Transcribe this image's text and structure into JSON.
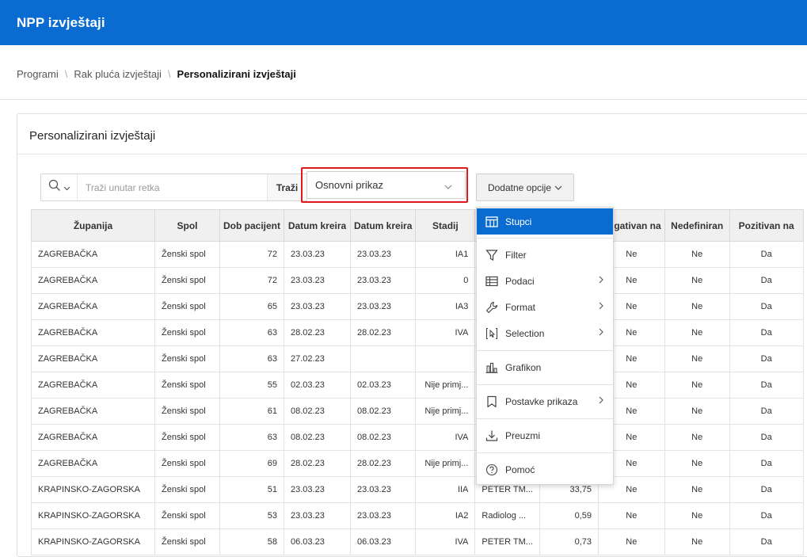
{
  "app": {
    "title": "NPP izvještaji"
  },
  "breadcrumb": {
    "items": [
      "Programi",
      "Rak pluća izvještaji"
    ],
    "current": "Personalizirani izvještaji",
    "separator": "\\"
  },
  "region": {
    "title": "Personalizirani izvještaji"
  },
  "search": {
    "placeholder": "Traži unutar retka",
    "value": "",
    "go_label": "Traži"
  },
  "report_select": {
    "value": "Osnovni prikaz"
  },
  "actions_button": {
    "label": "Dodatne opcije"
  },
  "table": {
    "headers": [
      "Županija",
      "Spol",
      "Dob pacijent",
      "Datum kreira",
      "Datum kreira",
      "Stadij",
      "",
      "",
      "Negativan na",
      "Nedefiniran",
      "Pozitivan na"
    ],
    "rows": [
      [
        "ZAGREBAČKA",
        "Ženski spol",
        "72",
        "23.03.23",
        "23.03.23",
        "IA1",
        "",
        "",
        "Ne",
        "Ne",
        "Da"
      ],
      [
        "ZAGREBAČKA",
        "Ženski spol",
        "72",
        "23.03.23",
        "23.03.23",
        "0",
        "",
        "",
        "Ne",
        "Ne",
        "Da"
      ],
      [
        "ZAGREBAČKA",
        "Ženski spol",
        "65",
        "23.03.23",
        "23.03.23",
        "IA3",
        "",
        "",
        "Ne",
        "Ne",
        "Da"
      ],
      [
        "ZAGREBAČKA",
        "Ženski spol",
        "63",
        "28.02.23",
        "28.02.23",
        "IVA",
        "",
        "",
        "Ne",
        "Ne",
        "Da"
      ],
      [
        "ZAGREBAČKA",
        "Ženski spol",
        "63",
        "27.02.23",
        "",
        "",
        "",
        "",
        "Ne",
        "Ne",
        "Da"
      ],
      [
        "ZAGREBAČKA",
        "Ženski spol",
        "55",
        "02.03.23",
        "02.03.23",
        "Nije primj...",
        "",
        "",
        "Ne",
        "Ne",
        "Da"
      ],
      [
        "ZAGREBAČKA",
        "Ženski spol",
        "61",
        "08.02.23",
        "08.02.23",
        "Nije primj...",
        "",
        "",
        "Ne",
        "Ne",
        "Da"
      ],
      [
        "ZAGREBAČKA",
        "Ženski spol",
        "63",
        "08.02.23",
        "08.02.23",
        "IVA",
        "",
        "",
        "Ne",
        "Ne",
        "Da"
      ],
      [
        "ZAGREBAČKA",
        "Ženski spol",
        "69",
        "28.02.23",
        "28.02.23",
        "Nije primj...",
        "",
        "",
        "Ne",
        "Ne",
        "Da"
      ],
      [
        "KRAPINSKO-ZAGORSKA",
        "Ženski spol",
        "51",
        "23.03.23",
        "23.03.23",
        "IIA",
        "PETER TM...",
        "33,75",
        "Ne",
        "Ne",
        "Da"
      ],
      [
        "KRAPINSKO-ZAGORSKA",
        "Ženski spol",
        "53",
        "23.03.23",
        "23.03.23",
        "IA2",
        "Radiolog ...",
        "0,59",
        "Ne",
        "Ne",
        "Da"
      ],
      [
        "KRAPINSKO-ZAGORSKA",
        "Ženski spol",
        "58",
        "06.03.23",
        "06.03.23",
        "IVA",
        "PETER TM...",
        "0,73",
        "Ne",
        "Ne",
        "Da"
      ]
    ]
  },
  "actions_menu": {
    "items": [
      {
        "label": "Stupci",
        "icon": "columns-icon",
        "submenu": false,
        "active": true
      },
      {
        "label": "Filter",
        "icon": "filter-icon",
        "submenu": false,
        "active": false
      },
      {
        "label": "Podaci",
        "icon": "table-icon",
        "submenu": true,
        "active": false
      },
      {
        "label": "Format",
        "icon": "wrench-icon",
        "submenu": true,
        "active": false
      },
      {
        "label": "Selection",
        "icon": "selection-icon",
        "submenu": true,
        "active": false
      },
      {
        "label": "Grafikon",
        "icon": "bar-chart-icon",
        "submenu": false,
        "active": false
      },
      {
        "label": "Postavke prikaza",
        "icon": "bookmark-icon",
        "submenu": true,
        "active": false
      },
      {
        "label": "Preuzmi",
        "icon": "download-icon",
        "submenu": false,
        "active": false
      },
      {
        "label": "Pomoć",
        "icon": "help-icon",
        "submenu": false,
        "active": false
      }
    ]
  },
  "colors": {
    "header_blue": "#0a6bd1",
    "highlight_red": "#e0191c",
    "menu_active": "#0a6bd1"
  }
}
